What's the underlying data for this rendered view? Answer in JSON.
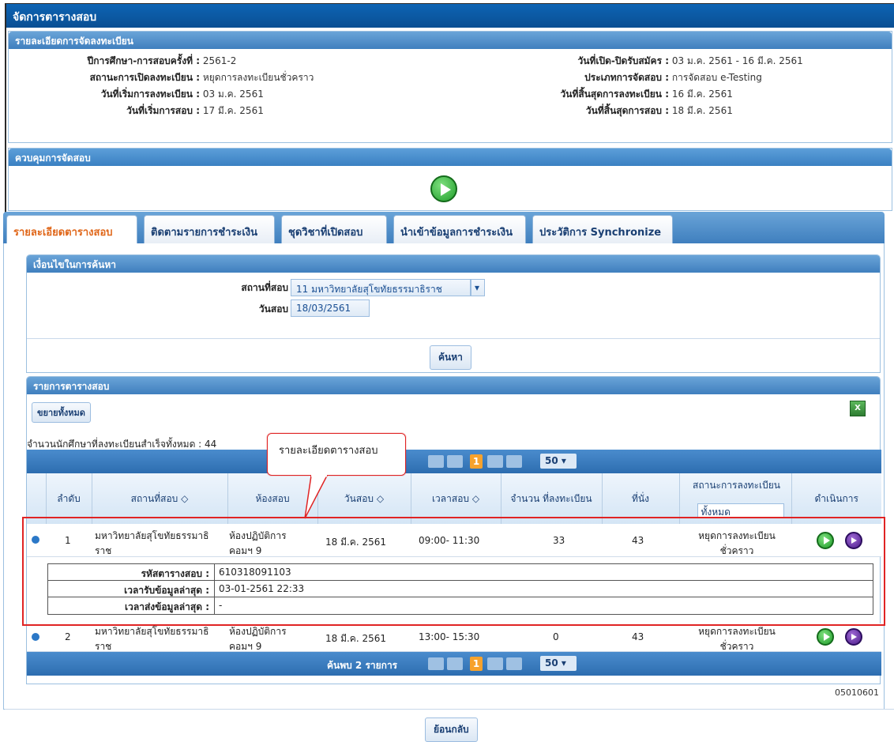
{
  "window": {
    "title": "จัดการตารางสอบ"
  },
  "registration": {
    "header": "รายละเอียดการจัดลงทะเบียน",
    "fields_left": [
      {
        "label": "ปีการศึกษา-การสอบครั้งที่ :",
        "value": "2561-2"
      },
      {
        "label": "สถานะการเปิดลงทะเบียน :",
        "value": "หยุดการลงทะเบียนชั่วคราว"
      },
      {
        "label": "วันที่เริ่มการลงทะเบียน :",
        "value": "03 ม.ค. 2561"
      },
      {
        "label": "วันที่เริ่มการสอบ :",
        "value": "17 มี.ค. 2561"
      }
    ],
    "fields_right": [
      {
        "label": "วันที่เปิด-ปิดรับสมัคร :",
        "value": "03 ม.ค. 2561 - 16 มี.ค. 2561"
      },
      {
        "label": "ประเภทการจัดสอบ :",
        "value": "การจัดสอบ e-Testing"
      },
      {
        "label": "วันที่สิ้นสุดการลงทะเบียน :",
        "value": "16 มี.ค. 2561"
      },
      {
        "label": "วันที่สิ้นสุดการสอบ :",
        "value": "18 มี.ค. 2561"
      }
    ]
  },
  "control": {
    "header": "ควบคุมการจัดสอบ",
    "start_icon": "play-icon"
  },
  "tabs": [
    {
      "label": "รายละเอียดตารางสอบ",
      "active": true
    },
    {
      "label": "ติดตามรายการชำระเงิน"
    },
    {
      "label": "ชุดวิชาที่เปิดสอบ"
    },
    {
      "label": "นำเข้าข้อมูลการชำระเงิน"
    },
    {
      "label": "ประวัติการ Synchronize"
    }
  ],
  "search": {
    "header": "เงื่อนไขในการค้นหา",
    "location_label": "สถานที่สอบ :",
    "location_value": "11 มหาวิทยาลัยสุโขทัยธรรมาธิราช",
    "date_label": "วันสอบ :",
    "date_value": "18/03/2561",
    "button": "ค้นหา"
  },
  "list": {
    "header": "รายการตารางสอบ",
    "expand_all": "ขยายทั้งหมด",
    "excel_icon": "excel-icon",
    "total_text": "จำนวนนักศึกษาที่ลงทะเบียนสำเร็จทั้งหมด : 44",
    "pager": {
      "found_text": "ค้นพบ 2 รายการ",
      "page": "1",
      "page_size": "50"
    },
    "columns": [
      "ลำดับ",
      "สถานที่สอบ ◇",
      "ห้องสอบ",
      "วันสอบ ◇",
      "เวลาสอบ ◇",
      "จำนวน ที่ลงทะเบียน",
      "ที่นั่ง",
      "สถานะการลงทะเบียน",
      "ดำเนินการ"
    ],
    "status_filter": "ทั้งหมด",
    "rows": [
      {
        "no": "1",
        "location": "มหาวิทยาลัยสุโขทัยธรรมาธิราช",
        "room": "ห้องปฏิบัติการคอมฯ 9",
        "date": "18 มี.ค. 2561",
        "time": "09:00- 11:30",
        "registered": "33",
        "seats": "43",
        "status": "หยุดการลงทะเบียนชั่วคราว"
      },
      {
        "no": "2",
        "location": "มหาวิทยาลัยสุโขทัยธรรมาธิราช",
        "room": "ห้องปฏิบัติการคอมฯ 9",
        "date": "18 มี.ค. 2561",
        "time": "13:00- 15:30",
        "registered": "0",
        "seats": "43",
        "status": "หยุดการลงทะเบียนชั่วคราว"
      }
    ],
    "detail": [
      {
        "label": "รหัสตารางสอบ :",
        "value": "610318091103"
      },
      {
        "label": "เวลารับข้อมูลล่าสุด :",
        "value": "03-01-2561 22:33"
      },
      {
        "label": "เวลาส่งข้อมูลล่าสุด :",
        "value": "-"
      }
    ]
  },
  "callout": {
    "text": "รายละเอียดตารางสอบ"
  },
  "page_code": "05010601",
  "footer": {
    "back_button": "ย้อนกลับ"
  }
}
